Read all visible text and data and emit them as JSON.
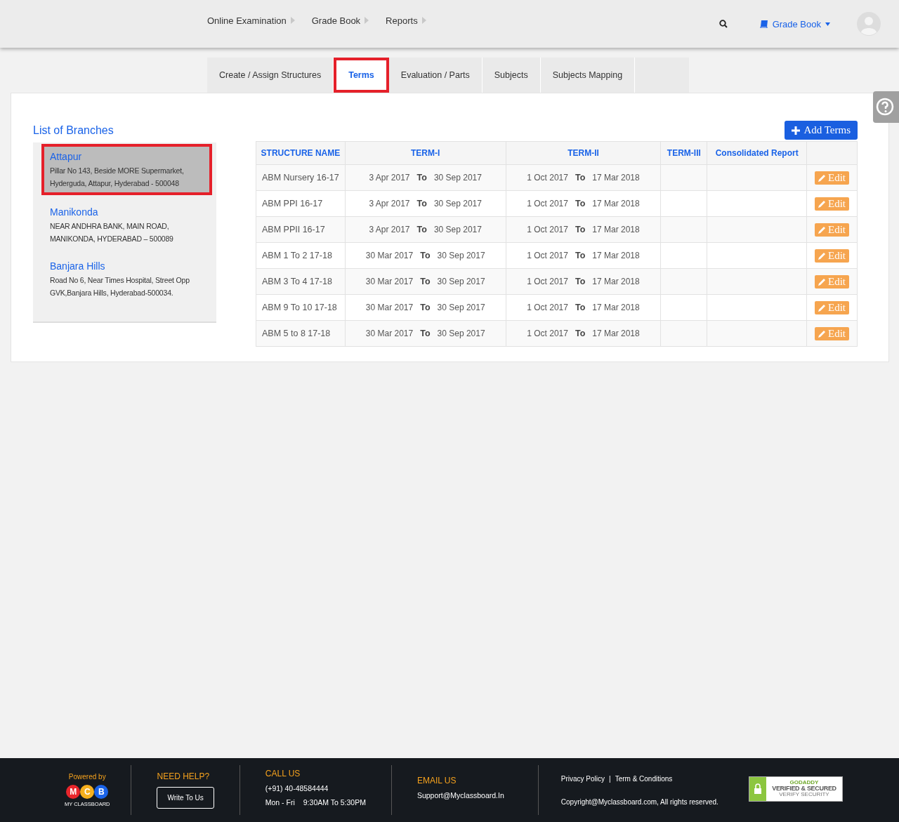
{
  "nav": {
    "menus": [
      {
        "label": "Online Examination"
      },
      {
        "label": "Grade Book"
      },
      {
        "label": "Reports"
      }
    ],
    "module": "Grade Book"
  },
  "tabs": [
    {
      "label": "Create / Assign Structures",
      "selected": false
    },
    {
      "label": "Terms",
      "selected": true
    },
    {
      "label": "Evaluation / Parts",
      "selected": false
    },
    {
      "label": "Subjects",
      "selected": false
    },
    {
      "label": "Subjects Mapping",
      "selected": false
    }
  ],
  "branches": {
    "title": "List of Branches",
    "items": [
      {
        "name": "Attapur",
        "address": "Pillar No 143, Beside MORE Supermarket, Hyderguda, Attapur, Hyderabad - 500048",
        "selected": true
      },
      {
        "name": "Manikonda",
        "address": "NEAR ANDHRA BANK, MAIN ROAD, MANIKONDA, HYDERABAD – 500089",
        "selected": false
      },
      {
        "name": "Banjara Hills",
        "address": "Road No 6, Near Times Hospital, Street Opp GVK,Banjara Hills, Hyderabad-500034.",
        "selected": false
      }
    ]
  },
  "add_button": "Add Terms",
  "table": {
    "columns": [
      "STRUCTURE NAME",
      "TERM-I",
      "TERM-II",
      "TERM-III",
      "Consolidated Report"
    ],
    "rows": [
      {
        "name": "ABM Nursery 16-17",
        "term_1": [
          "3 Apr 2017",
          "To",
          "30 Sep 2017"
        ],
        "term_2": [
          "1 Oct 2017",
          "To",
          "17 Mar 2018"
        ],
        "action": "Edit"
      },
      {
        "name": "ABM PPI 16-17",
        "term_1": [
          "3 Apr 2017",
          "To",
          "30 Sep 2017"
        ],
        "term_2": [
          "1 Oct 2017",
          "To",
          "17 Mar 2018"
        ],
        "action": "Edit"
      },
      {
        "name": "ABM PPII 16-17",
        "term_1": [
          "3 Apr 2017",
          "To",
          "30 Sep 2017"
        ],
        "term_2": [
          "1 Oct 2017",
          "To",
          "17 Mar 2018"
        ],
        "action": "Edit"
      },
      {
        "name": "ABM 1 To 2 17-18",
        "term_1": [
          "30 Mar 2017",
          "To",
          "30 Sep 2017"
        ],
        "term_2": [
          "1 Oct 2017",
          "To",
          "17 Mar 2018"
        ],
        "action": "Edit"
      },
      {
        "name": "ABM 3 To 4 17-18",
        "term_1": [
          "30 Mar 2017",
          "To",
          "30 Sep 2017"
        ],
        "term_2": [
          "1 Oct 2017",
          "To",
          "17 Mar 2018"
        ],
        "action": "Edit"
      },
      {
        "name": "ABM 9 To 10 17-18",
        "term_1": [
          "30 Mar 2017",
          "To",
          "30 Sep 2017"
        ],
        "term_2": [
          "1 Oct 2017",
          "To",
          "17 Mar 2018"
        ],
        "action": "Edit"
      },
      {
        "name": "ABM 5 to 8 17-18",
        "term_1": [
          "30 Mar 2017",
          "To",
          "30 Sep 2017"
        ],
        "term_2": [
          "1 Oct 2017",
          "To",
          "17 Mar 2018"
        ],
        "action": "Edit"
      }
    ]
  },
  "footer": {
    "powered_by": "Powered by",
    "logo_letters": [
      {
        "letter": "M",
        "color": "#e8262c"
      },
      {
        "letter": "C",
        "color": "#f6b01d"
      },
      {
        "letter": "B",
        "color": "#1a63e8"
      }
    ],
    "logo_caption": "MY CLASSBOARD",
    "help_title": "NEED HELP?",
    "write_button": "Write To Us",
    "call_title": "CALL US",
    "phone": "(+91) 40-48584444",
    "days": "Mon - Fri",
    "hours": "9:30AM To 5:30PM",
    "email_title": "EMAIL US",
    "email": "Support@Myclassboard.In",
    "links": [
      "Privacy Policy",
      "Term & Conditions"
    ],
    "separator": "|",
    "copyright": "Copyright@Myclassboard.com, All rights reserved.",
    "seal": [
      "GODADDY",
      "VERIFIED & SECURED",
      "VERIFY SECURITY"
    ]
  }
}
